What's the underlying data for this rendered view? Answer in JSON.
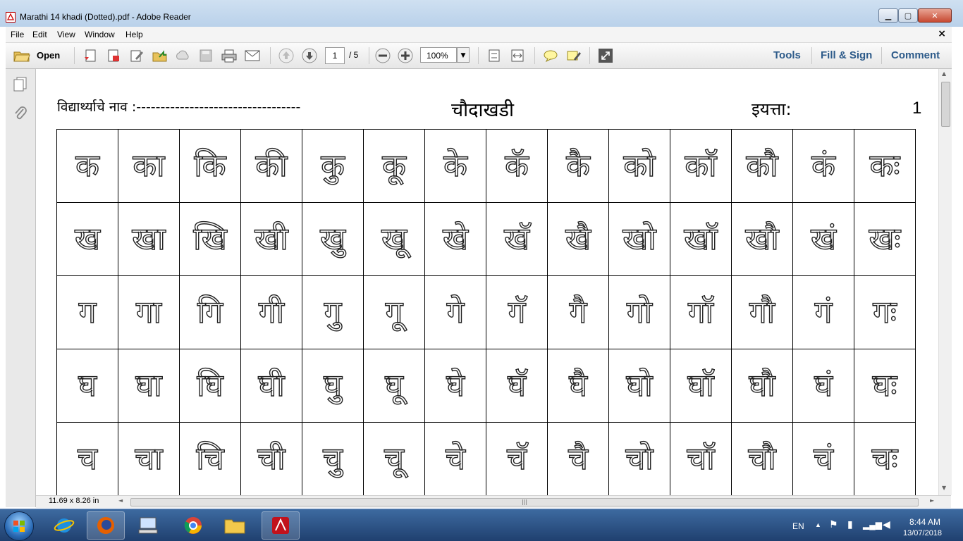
{
  "window": {
    "title": "Marathi 14 khadi (Dotted).pdf - Adobe Reader",
    "min_label": "▁",
    "max_label": "▢",
    "close_label": "✕"
  },
  "menu": {
    "items": [
      "File",
      "Edit",
      "View",
      "Window",
      "Help"
    ],
    "close_label": "×"
  },
  "toolbar": {
    "open_label": "Open",
    "page_current": "1",
    "page_total": "/ 5",
    "zoom": "100%",
    "right_links": [
      "Tools",
      "Fill & Sign",
      "Comment"
    ]
  },
  "document": {
    "student_name_label": "विद्यार्थ्याचे नाव :----------------------------------",
    "title": "चौदाखडी",
    "grade_label": "इयत्ता:",
    "page_number": "1",
    "rows": [
      [
        "क",
        "का",
        "कि",
        "की",
        "कु",
        "कू",
        "के",
        "कॅ",
        "कै",
        "को",
        "कॉ",
        "कौ",
        "कं",
        "कः"
      ],
      [
        "ख",
        "खा",
        "खि",
        "खी",
        "खु",
        "खू",
        "खे",
        "खॅ",
        "खै",
        "खो",
        "खॉ",
        "खौ",
        "खं",
        "खः"
      ],
      [
        "ग",
        "गा",
        "गि",
        "गी",
        "गु",
        "गू",
        "गे",
        "गॅ",
        "गै",
        "गो",
        "गॉ",
        "गौ",
        "गं",
        "गः"
      ],
      [
        "घ",
        "घा",
        "घि",
        "घी",
        "घु",
        "घू",
        "घे",
        "घॅ",
        "घै",
        "घो",
        "घॉ",
        "घौ",
        "घं",
        "घः"
      ],
      [
        "च",
        "चा",
        "चि",
        "ची",
        "चु",
        "चू",
        "चे",
        "चॅ",
        "चै",
        "चो",
        "चॉ",
        "चौ",
        "चं",
        "चः"
      ]
    ]
  },
  "status": {
    "page_size": "11.69 x 8.26 in"
  },
  "taskbar": {
    "language": "EN",
    "time": "8:44 AM",
    "date": "13/07/2018"
  }
}
